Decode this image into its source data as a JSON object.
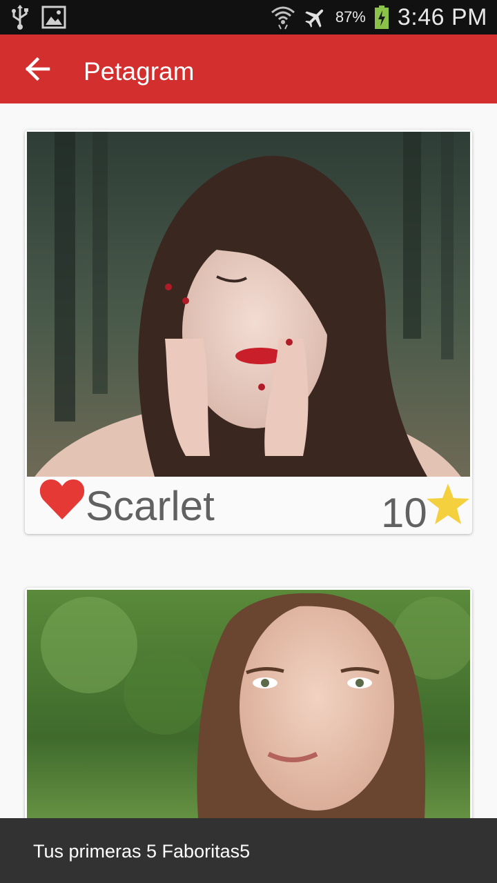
{
  "status_bar": {
    "battery": "87%",
    "time": "3:46 PM",
    "icons": [
      "usb-icon",
      "image-icon",
      "wifi-icon",
      "airplane-icon",
      "battery-charging-icon"
    ]
  },
  "app_bar": {
    "title": "Petagram",
    "back_icon": "arrow-left-icon",
    "color": "#d32f2f"
  },
  "pets": [
    {
      "name": "Scarlet",
      "rating": "10",
      "like_icon": "heart-icon",
      "rating_icon": "star-icon"
    },
    {
      "name": "",
      "rating": ""
    }
  ],
  "snackbar": {
    "message": "Tus primeras 5 Faboritas5"
  },
  "colors": {
    "accent": "#d32f2f",
    "heart": "#e53935",
    "star": "#f4d03f"
  }
}
